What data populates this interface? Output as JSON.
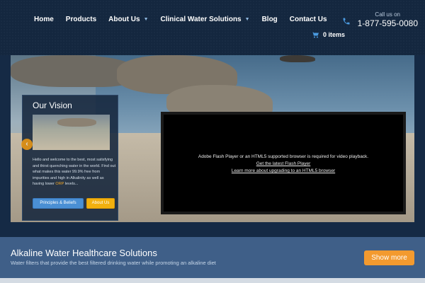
{
  "nav": {
    "items": [
      {
        "label": "Home"
      },
      {
        "label": "Products"
      },
      {
        "label": "About Us"
      },
      {
        "label": "Clinical Water Solutions"
      },
      {
        "label": "Blog"
      },
      {
        "label": "Contact Us"
      }
    ]
  },
  "contact": {
    "call_label": "Call us on",
    "phone": "1-877-595-0080"
  },
  "cart": {
    "label": "0 items"
  },
  "vision": {
    "title": "Our Vision",
    "text_before": "Hello and welcome to the best, most satisfying and thirst quenching water in the world. Find out what makes this water 99.9% free from impurities and high in Alkalinity as well as having lower ",
    "orp": "ORP",
    "text_after": " levels...",
    "principles_label": "Principles & Beliefs",
    "about_label": "About Us"
  },
  "video": {
    "message": "Adobe Flash Player or an HTML5 supported browser is required for video playback.",
    "link1": "Get the latest Flash Player",
    "link2": "Learn more about upgrading to an HTML5 browser"
  },
  "band": {
    "title": "Alkaline Water Healthcare Solutions",
    "subtitle": "Water filters that provide the best filtered drinking water while promoting an alkaline diet",
    "button": "Show more"
  },
  "icons": {
    "phone": "phone-icon",
    "cart": "cart-icon",
    "chevron": "chevron-down-icon",
    "prev": "chevron-left-icon",
    "next": "chevron-right-icon"
  },
  "colors": {
    "accent_orange": "#f39a2f",
    "about_button": "#f2b00e",
    "principles_button": "#4a8fd4",
    "band": "#3f5f88",
    "header": "#14273f"
  }
}
